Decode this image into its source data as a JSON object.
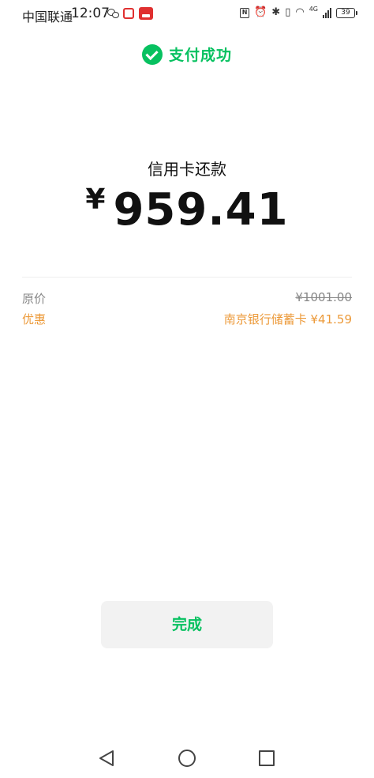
{
  "status_bar": {
    "carrier": "中国联通",
    "time": "12:07",
    "network": "4G",
    "battery": "39"
  },
  "header": {
    "title": "支付成功"
  },
  "payment": {
    "type": "信用卡还款",
    "currency_symbol": "¥",
    "amount": "959.41"
  },
  "details": {
    "original_label": "原价",
    "original_value": "¥1001.00",
    "discount_label": "优惠",
    "discount_value": "南京银行储蓄卡 ¥41.59"
  },
  "actions": {
    "done_label": "完成"
  },
  "colors": {
    "accent": "#07c160",
    "discount": "#ec9a3a",
    "muted": "#888888"
  },
  "icons": {
    "header": "pay-success-icon",
    "nav": [
      "back-icon",
      "home-icon",
      "recent-apps-icon"
    ]
  }
}
